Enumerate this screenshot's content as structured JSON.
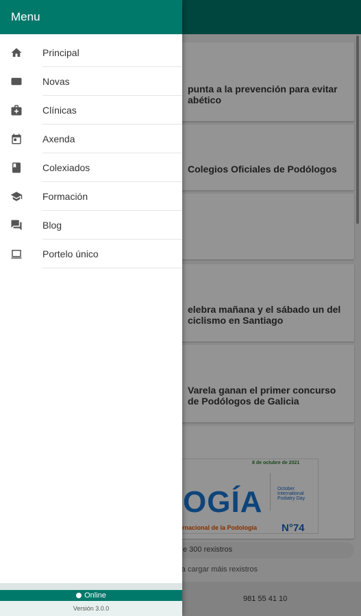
{
  "drawer": {
    "title": "Menu",
    "items": [
      {
        "label": "Principal",
        "icon": "home-icon"
      },
      {
        "label": "Novas",
        "icon": "newspaper-icon"
      },
      {
        "label": "Clínicas",
        "icon": "medical-bag-icon"
      },
      {
        "label": "Axenda",
        "icon": "calendar-icon"
      },
      {
        "label": "Colexiados",
        "icon": "book-icon"
      },
      {
        "label": "Formación",
        "icon": "school-icon"
      },
      {
        "label": "Blog",
        "icon": "chat-icon"
      },
      {
        "label": "Portelo único",
        "icon": "tablet-icon"
      }
    ],
    "status": "Online",
    "version": "Versión 3.0.0"
  },
  "feed": {
    "cards": [
      {
        "title": "punta a la prevención para evitar abético"
      },
      {
        "title": "Colegios Oficiales de Podólogos"
      },
      {
        "title": ""
      },
      {
        "title": "elebra mañana y el sábado un del ciclismo en Santiago"
      },
      {
        "title": "Varela ganan el primer concurso de Podólogos de Galicia"
      }
    ],
    "poster": {
      "date": "8 de octubre de 2021",
      "big": "OGÍA",
      "subtitle": "ernacional de la Podología",
      "number": "N°74",
      "badge": "October International Podiatry Day"
    },
    "records_text": "e 300 rexistros",
    "more_hint": "ara cargar máis rexistros"
  },
  "footer": {
    "phone": "981 55 41 10"
  },
  "colors": {
    "primary": "#00796b",
    "drawer_bg": "#ffffff"
  }
}
